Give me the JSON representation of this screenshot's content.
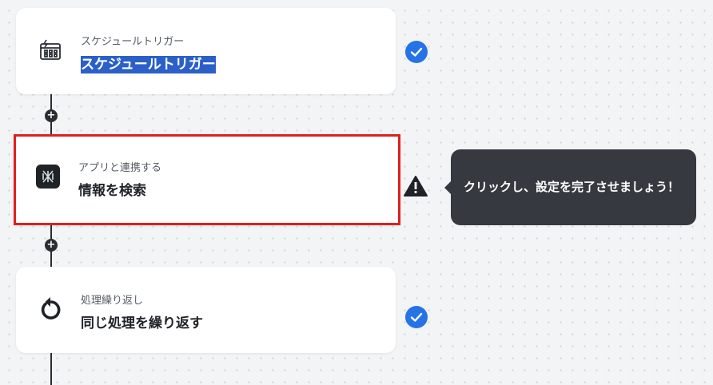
{
  "steps": [
    {
      "subtitle": "スケジュールトリガー",
      "title": "スケジュールトリガー",
      "icon": "calendar-lightning-icon",
      "status": "complete"
    },
    {
      "subtitle": "アプリと連携する",
      "title": "情報を検索",
      "icon": "app-logo-icon",
      "status": "warning"
    },
    {
      "subtitle": "処理繰り返し",
      "title": "同じ処理を繰り返す",
      "icon": "refresh-icon",
      "status": "complete"
    }
  ],
  "tooltip": {
    "text": "クリックし、設定を完了させましょう！"
  },
  "colors": {
    "check": "#2573e6",
    "selected_border": "#e0201f",
    "tooltip_bg": "#363a40",
    "connector": "#2a2d33"
  }
}
